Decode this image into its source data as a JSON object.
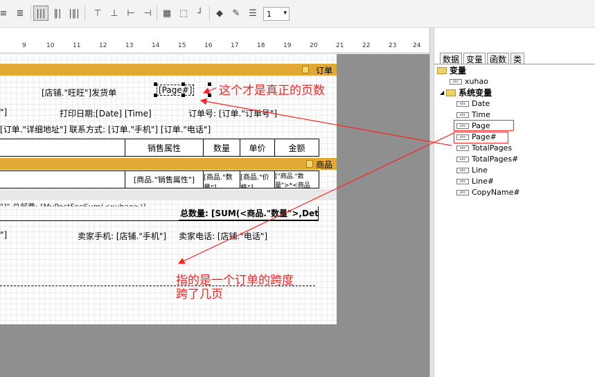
{
  "toolbar": {
    "zoom_value": "1",
    "zoom_arrow": "▾"
  },
  "ruler": {
    "ticks": [
      "9",
      "10",
      "11",
      "12",
      "13",
      "14",
      "15",
      "16",
      "17",
      "18",
      "19",
      "20",
      "21",
      "22",
      "23",
      "24"
    ]
  },
  "bands": {
    "order": "订单",
    "product": "商品"
  },
  "report": {
    "shop_title": "[店铺.\"旺旺\"]发货单",
    "page_field": "[Page#]",
    "print_date": "打印日期:[Date] [Time]",
    "order_no": "订单号: [订单.\"订单号\"]",
    "address_line": "[订单.\"详细地址\"] 联系方式: [订单.\"手机\"] [订单.\"电话\"]",
    "left_bracket": "\"]",
    "header_cells": [
      "销售属性",
      "数量",
      "单价",
      "金额"
    ],
    "row_cells": [
      "[商品.\"销售属性\"]",
      "[商品.\"数量\"]",
      "[商品.\"价格\"]",
      "[\"商品.\"数量\">*<商品"
    ],
    "footer_text": "\"]\"  总邮费: [MyPostFeeSum(<xuhao>)]",
    "total_qty": "总数量: [SUM(<商品.\"数量\">,Detail",
    "seller_mobile": "卖家手机: [店铺.\"手机\"]",
    "seller_phone": "卖家电话: [店铺.\"电话\"]",
    "left_bracket2": "\"]"
  },
  "annotations": {
    "page_note": "这个才是真正的页数",
    "span_note_1": "指的是一个订单的跨度",
    "span_note_2": "跨了几页"
  },
  "panel": {
    "tabs": [
      "数据",
      "变量",
      "函数",
      "类"
    ],
    "tree": {
      "root": "变量",
      "items": [
        "xuhao"
      ],
      "system_group": "系统变量",
      "system_items": [
        "Date",
        "Time",
        "Page",
        "Page#",
        "TotalPages",
        "TotalPages#",
        "Line",
        "Line#",
        "CopyName#"
      ]
    }
  },
  "colors": {
    "band": "#e2a834",
    "annotation": "#ff2020",
    "canvas": "#8f8f8f"
  }
}
